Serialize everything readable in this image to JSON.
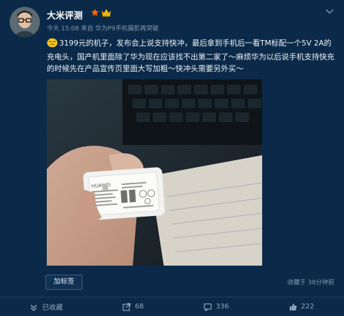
{
  "post": {
    "author_name": "大米评测",
    "meta": "今天 15:08 来自 华为P9手机摄影再突破",
    "text": "3199元的机子，发布会上说支持快冲，最后拿到手机后一看TM标配一个5V 2A的充电头，国产机里面除了华为现在应该找不出第二家了～麻烦华为以后说手机支持快充的时候先在产品宣传页里面大写加粗～快冲头需要另外买～",
    "tag_button": "加标签",
    "collected": "收藏于 38分钟前"
  },
  "image": {
    "charger_brand": "HUAWEI"
  },
  "actions": [
    {
      "icon": "collection-icon",
      "label": "已收藏"
    },
    {
      "icon": "repost-icon",
      "label": "68"
    },
    {
      "icon": "comment-icon",
      "label": "336"
    },
    {
      "icon": "like-icon",
      "label": "222"
    }
  ],
  "colors": {
    "background": "#0b2a49",
    "accent": "#ff6a00",
    "muted_text": "#7f97ad"
  }
}
